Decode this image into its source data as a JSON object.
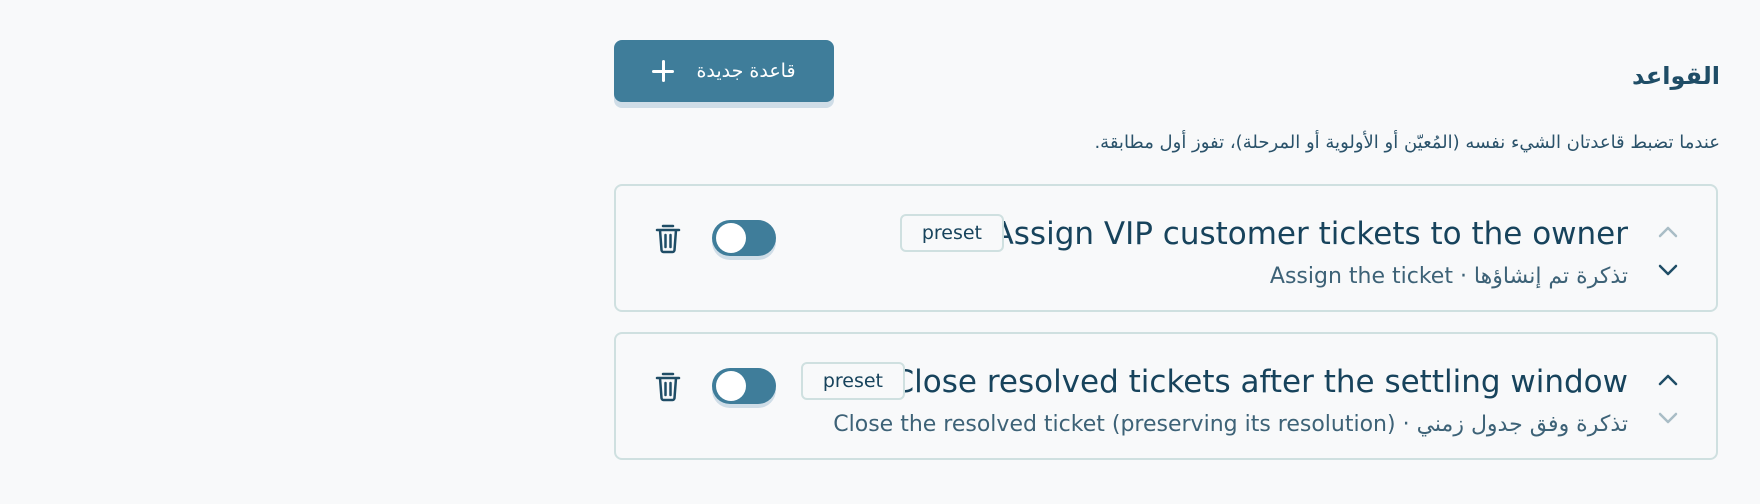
{
  "header": {
    "title": "القواعد",
    "new_rule_label": "قاعدة جديدة",
    "subtitle": "عندما تضبط قاعدتان الشيء نفسه (المُعيّن أو الأولوية أو المرحلة)، تفوز أول مطابقة."
  },
  "rules": [
    {
      "name": "Assign VIP customer tickets to the owner",
      "badge": "preset",
      "description": "تذكرة تم إنشاؤها · Assign the ticket",
      "enabled": true
    },
    {
      "name": "Close resolved tickets after the settling window",
      "badge": "preset",
      "description": "تذكرة وفق جدول زمني · Close the resolved ticket (preserving its resolution)",
      "enabled": true
    }
  ],
  "icons": {
    "plus": "plus-icon",
    "trash": "trash-icon",
    "chevron_up": "chevron-up-icon",
    "chevron_down": "chevron-down-icon"
  },
  "colors": {
    "accent": "#3f7d9a",
    "text": "#17435c",
    "border": "#cfe0e0",
    "muted_chevron": "#a9bdc6"
  }
}
